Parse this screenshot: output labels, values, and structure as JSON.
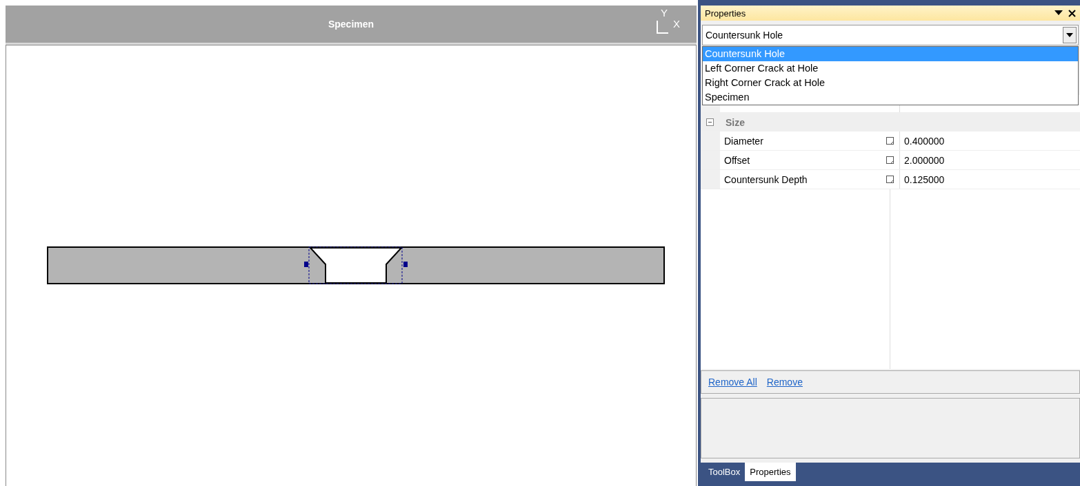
{
  "view": {
    "title": "Specimen",
    "axis_labels": {
      "y": "Y",
      "x": "X"
    }
  },
  "properties": {
    "title": "Properties",
    "object_combo": {
      "value": "Countersunk Hole"
    },
    "dropdown": [
      {
        "label": "Countersunk Hole",
        "selected": true
      },
      {
        "label": "Left Corner Crack at Hole",
        "selected": false
      },
      {
        "label": "Right Corner Crack at Hole",
        "selected": false
      },
      {
        "label": "Specimen",
        "selected": false
      }
    ],
    "categories": [
      {
        "name": "Size",
        "expanded": true,
        "rows": [
          {
            "name": "Diameter",
            "value": "0.400000"
          },
          {
            "name": "Offset",
            "value": "2.000000"
          },
          {
            "name": "Countersunk Depth",
            "value": "0.125000"
          }
        ]
      }
    ],
    "links": [
      "Remove All",
      "Remove"
    ]
  },
  "tabs": [
    {
      "label": "ToolBox",
      "selected": false
    },
    {
      "label": "Properties",
      "selected": true
    }
  ]
}
